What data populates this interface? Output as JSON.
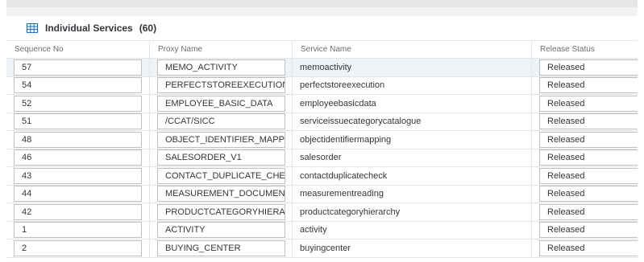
{
  "header": {
    "title": "Individual Services",
    "count": "(60)",
    "icon": "table-grid-icon"
  },
  "columns": {
    "sequence_no": "Sequence No",
    "proxy_name": "Proxy Name",
    "service_name": "Service Name",
    "release_status": "Release Status"
  },
  "rows": [
    {
      "seq": "57",
      "proxy": "MEMO_ACTIVITY",
      "service": "memoactivity",
      "status": "Released"
    },
    {
      "seq": "54",
      "proxy": "PERFECTSTOREEXECUTION",
      "service": "perfectstoreexecution",
      "status": "Released"
    },
    {
      "seq": "52",
      "proxy": "EMPLOYEE_BASIC_DATA",
      "service": "employeebasicdata",
      "status": "Released"
    },
    {
      "seq": "51",
      "proxy": "/CCAT/SICC",
      "service": "serviceissuecategorycatalogue",
      "status": "Released"
    },
    {
      "seq": "48",
      "proxy": "OBJECT_IDENTIFIER_MAPPI...",
      "service": "objectidentifiermapping",
      "status": "Released"
    },
    {
      "seq": "46",
      "proxy": "SALESORDER_V1",
      "service": "salesorder",
      "status": "Released"
    },
    {
      "seq": "43",
      "proxy": "CONTACT_DUPLICATE_CHECK",
      "service": "contactduplicatecheck",
      "status": "Released"
    },
    {
      "seq": "44",
      "proxy": "MEASUREMENT_DOCUMENT",
      "service": "measurementreading",
      "status": "Released"
    },
    {
      "seq": "42",
      "proxy": "PRODUCTCATEGORYHIERAR...",
      "service": "productcategoryhierarchy",
      "status": "Released"
    },
    {
      "seq": "1",
      "proxy": "ACTIVITY",
      "service": "activity",
      "status": "Released"
    },
    {
      "seq": "2",
      "proxy": "BUYING_CENTER",
      "service": "buyingcenter",
      "status": "Released"
    }
  ]
}
